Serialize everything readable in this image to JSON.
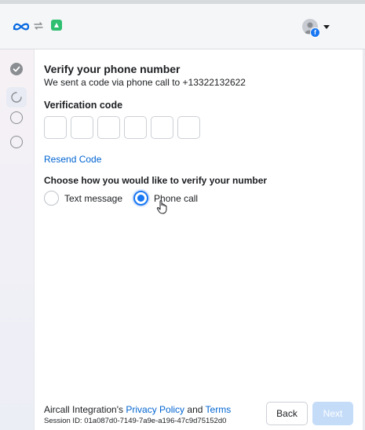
{
  "header": {
    "logo": "meta-logo",
    "avatar_badge": "f",
    "icons": [
      "meta-logo",
      "link-arrows-icon",
      "app-icon",
      "avatar",
      "chevron-down-icon"
    ]
  },
  "sidebar": {
    "steps": [
      "completed",
      "current",
      "pending",
      "pending"
    ]
  },
  "main": {
    "title": "Verify your phone number",
    "subtitle": "We sent a code via phone call to +13322132622",
    "code_label": "Verification code",
    "code_boxes": [
      "",
      "",
      "",
      "",
      "",
      ""
    ],
    "resend_label": "Resend Code",
    "choose_label": "Choose how you would like to verify your number",
    "options": [
      {
        "label": "Text message",
        "selected": false
      },
      {
        "label": "Phone call",
        "selected": true
      }
    ]
  },
  "footer": {
    "prefix": "Aircall Integration's",
    "privacy_label": "Privacy Policy",
    "and_label": "and",
    "terms_label": "Terms",
    "session_id": "Session ID: 01a087d0-7149-7a9e-a196-47c9d75152d0",
    "back_label": "Back",
    "next_label": "Next"
  },
  "colors": {
    "accent": "#1877f2",
    "link": "#0064d1",
    "next_disabled": "#c5dcf9"
  }
}
